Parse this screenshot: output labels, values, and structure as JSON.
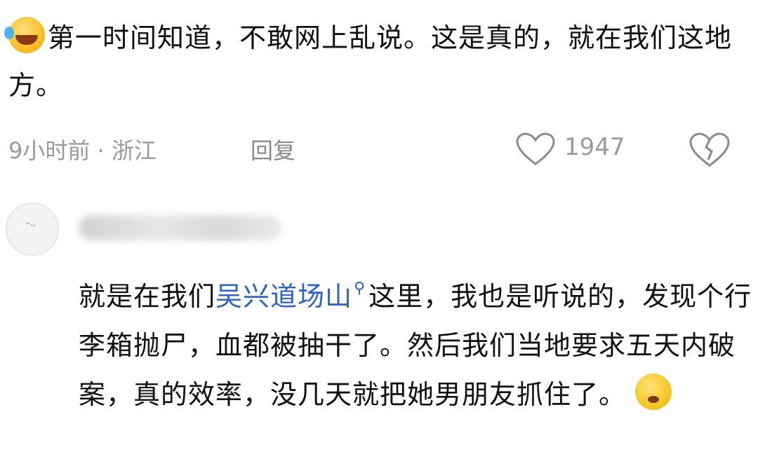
{
  "top_comment": {
    "emoji": "laughing-crying-emoji",
    "text": "第一时间知道，不敢网上乱说。这是真的，就在我们这地方。",
    "time": "9小时前 · 浙江",
    "reply_label": "回复",
    "like_count": "1947"
  },
  "reply": {
    "text_before": "就是在我们",
    "link": "吴兴道场山",
    "text_after": "这里，我也是听说的，发现个行李箱抛尸，血都被抽干了。然后我们当地要求五天内破案，真的效率，没几天就把她男朋友抓住了。",
    "emoji": "pouting-emoji"
  },
  "colors": {
    "link": "#2f63c4",
    "meta": "#9a9a9a"
  }
}
